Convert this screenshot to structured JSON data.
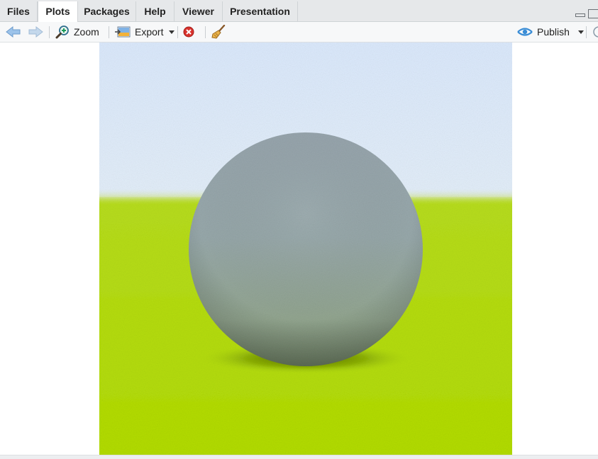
{
  "tabs": [
    {
      "label": "Files",
      "active": false
    },
    {
      "label": "Plots",
      "active": true
    },
    {
      "label": "Packages",
      "active": false
    },
    {
      "label": "Help",
      "active": false
    },
    {
      "label": "Viewer",
      "active": false
    },
    {
      "label": "Presentation",
      "active": false
    }
  ],
  "toolbar": {
    "back_icon": "arrow-left-icon",
    "forward_icon": "arrow-right-icon",
    "zoom_label": "Zoom",
    "zoom_icon": "zoom-magnifier-icon",
    "export_label": "Export",
    "export_icon": "export-image-icon",
    "remove_icon": "remove-plot-icon",
    "clear_icon": "broom-icon",
    "publish_label": "Publish",
    "publish_icon": "publish-eye-icon"
  },
  "plot": {
    "scene": "rendered sphere on green ground plane under light blue sky",
    "colors": {
      "sky": "#dce9fb",
      "ground": "#b8e000",
      "sphere": "#9aa7ac"
    }
  }
}
